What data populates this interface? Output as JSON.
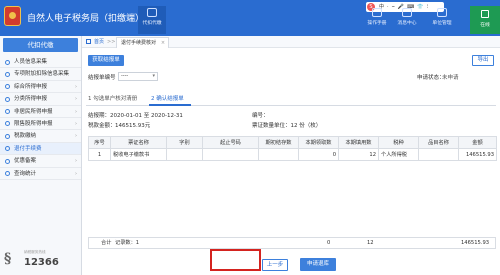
{
  "app": {
    "title": "自然人电子税务局（扣缴端）"
  },
  "topnav": {
    "current_tab": "代扣代缴",
    "right_items": [
      "操作手册",
      "消息中心",
      "单位管理"
    ],
    "exit_label": "在线"
  },
  "ime_toolbar": {
    "brand": "S",
    "items": [
      "中",
      "·",
      "⌣",
      "🎤",
      "⌨",
      "👕",
      "⁝"
    ]
  },
  "sidebar": {
    "header": "代扣代缴",
    "items": [
      {
        "label": "人员信息采集",
        "icon": "person-icon",
        "arrow": false
      },
      {
        "label": "专项附加扣除信息采集",
        "icon": "list-icon",
        "arrow": false
      },
      {
        "label": "综合所得申报",
        "icon": "doc-icon",
        "arrow": true
      },
      {
        "label": "分类所得申报",
        "icon": "doc-icon",
        "arrow": true
      },
      {
        "label": "非居民所得申报",
        "icon": "doc-icon",
        "arrow": true
      },
      {
        "label": "限售股所得申报",
        "icon": "doc-icon",
        "arrow": true
      },
      {
        "label": "税款缴纳",
        "icon": "money-icon",
        "arrow": true
      },
      {
        "label": "退付手续费",
        "icon": "refund-icon",
        "arrow": false,
        "active": true
      },
      {
        "label": "优惠备案",
        "icon": "star-icon",
        "arrow": true
      },
      {
        "label": "查询统计",
        "icon": "search-icon",
        "arrow": true
      }
    ],
    "hotline": {
      "small": "纳税服务热线",
      "number": "12366"
    }
  },
  "breadcrumb": {
    "home": "首页",
    "sep": ">>",
    "tab": "退付手续费核对"
  },
  "toolbar": {
    "fetch_button": "获取结报单",
    "export_button": "导出"
  },
  "form": {
    "report_no_label": "结报单编号",
    "report_no_value": "----",
    "status_label": "申请状态：",
    "status_value": "未申请"
  },
  "steps": {
    "step1": "1 勾选单户核对清册",
    "step2": "2 确认结报单"
  },
  "summary": {
    "period_label": "结报期：",
    "period_value": "2020-01-01 至 2020-12-31",
    "number_label": "编号：",
    "number_value": "",
    "amount_label": "税款金额：",
    "amount_value": "146515.93元",
    "ticket_count": "票证数量单位：12 份（枚）"
  },
  "table": {
    "headers": [
      "序号",
      "票证名称",
      "字别",
      "起止号码",
      "期初结存数",
      "本期领取数",
      "本期填用数",
      "税种",
      "品目名称",
      "金额"
    ],
    "rows": [
      [
        "1",
        "税收电子缴款书",
        "",
        "",
        "",
        "0",
        "12",
        "个人所得税",
        "",
        "146515.93"
      ]
    ],
    "footer": {
      "total_label": "合计",
      "records_label": "记录数：1",
      "zero": "0",
      "count": "12",
      "amount": "146515.93"
    }
  },
  "actions": {
    "prev_button": "上一步",
    "submit_button": "申请退库"
  },
  "colors": {
    "primary": "#2a6cd0",
    "highlight": "#d4231f"
  }
}
